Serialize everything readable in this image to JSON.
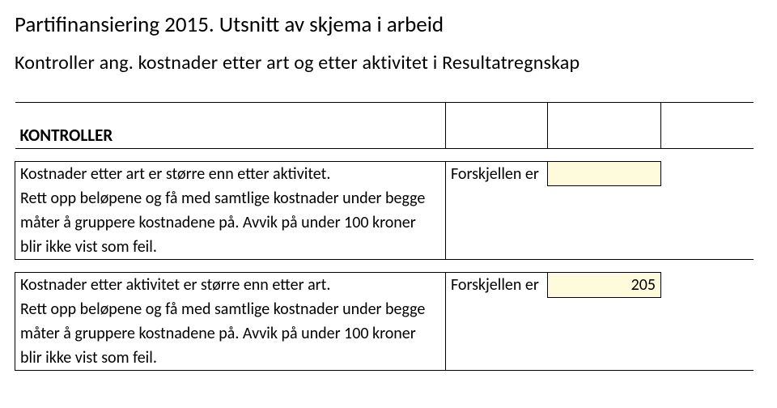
{
  "title": "Partifinansiering 2015. Utsnitt av skjema i arbeid",
  "subtitle": "Kontroller ang. kostnader etter art og etter aktivitet i Resultatregnskap",
  "section_heading": "KONTROLLER",
  "block1": {
    "line1": "Kostnader etter art er større enn etter aktivitet.",
    "label": "Forskjellen er",
    "value": "",
    "line2": "Rett opp beløpene og få med samtlige kostnader under begge",
    "line3": "måter å gruppere kostnadene på. Avvik på under 100 kroner",
    "line4": "blir ikke vist som feil."
  },
  "block2": {
    "line1": "Kostnader etter aktivitet er større enn etter art.",
    "label": "Forskjellen er",
    "value": "205",
    "line2": "Rett opp beløpene og få med samtlige kostnader under begge",
    "line3": "måter å gruppere kostnadene på. Avvik på under 100 kroner",
    "line4": "blir ikke vist som feil."
  }
}
